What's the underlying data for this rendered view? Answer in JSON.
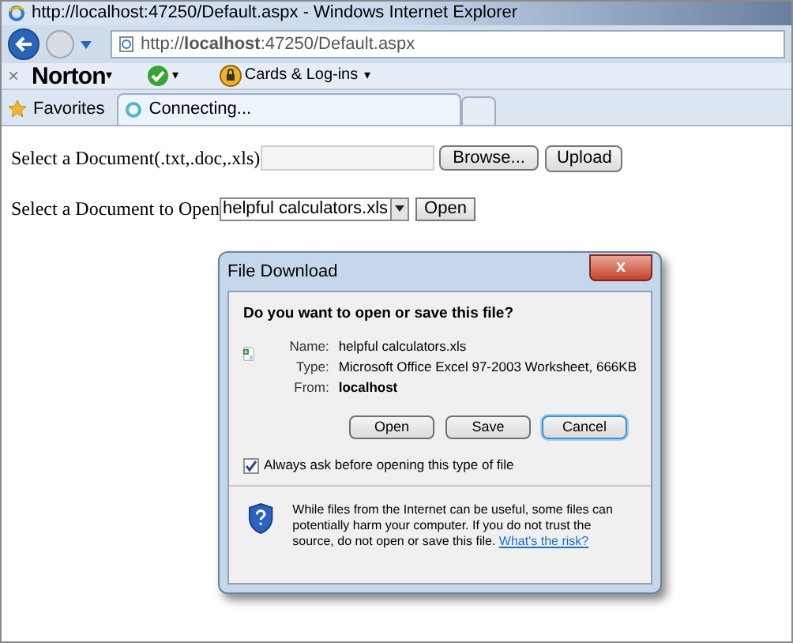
{
  "window": {
    "title": "http://localhost:47250/Default.aspx - Windows Internet Explorer"
  },
  "address_bar": {
    "value": "http://**localhost**:47250/Default.aspx"
  },
  "norton_toolbar": {
    "close": "×",
    "brand": "Norton",
    "brand_caret": "▾",
    "check_caret": "▾",
    "cards": "Cards & Log-ins",
    "cards_caret": "▾"
  },
  "favorites_bar": {
    "favorites": "Favorites",
    "tabs": [
      {
        "label": "Connecting...",
        "selected": true
      }
    ]
  },
  "page": {
    "upload_label": "Select a Document(.txt,.doc,.xls)",
    "browse_button": "Browse...",
    "upload_button": "Upload",
    "open_label": "Select a Document to Open",
    "document_select": "helpful calculators.xls",
    "open_button": "Open"
  },
  "dialog": {
    "title": "File Download",
    "close": "x",
    "question": "Do you want to open or save this file?",
    "fields": [
      {
        "label": "Name:",
        "value": "helpful calculators.xls",
        "bold": false
      },
      {
        "label": "Type:",
        "value": "Microsoft Office Excel 97-2003 Worksheet, 666KB",
        "bold": false
      },
      {
        "label": "From:",
        "value": "localhost",
        "bold": true
      }
    ],
    "buttons": [
      {
        "label": "Open",
        "default": false
      },
      {
        "label": "Save",
        "default": false
      },
      {
        "label": "Cancel",
        "default": true
      }
    ],
    "always_ask": {
      "label": "Always ask before opening this type of file",
      "checked": true
    },
    "warning": "While files from the Internet can be useful, some files can potentially harm your computer. If you do not trust the source, do not open or save this file.",
    "risk_link": "What's the risk?"
  }
}
